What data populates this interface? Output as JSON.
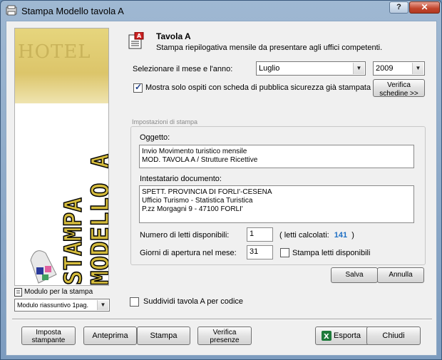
{
  "window": {
    "title": "Stampa Modello tavola A",
    "help_label": "?",
    "close_label": "✕"
  },
  "banner": {
    "hotel_word": "HOTEL",
    "vertical_line1": "STAMPA",
    "vertical_line2": "MODELLO A"
  },
  "header": {
    "title": "Tavola A",
    "subtitle": "Stampa riepilogativa mensile da presentare agli uffici competenti."
  },
  "period": {
    "label": "Selezionare il mese e l'anno:",
    "month": "Luglio",
    "year": "2009"
  },
  "filter": {
    "checked": true,
    "label": "Mostra solo ospiti con scheda di pubblica sicurezza già stampata",
    "verify_button_line1": "Verifica",
    "verify_button_line2": "schedine >>"
  },
  "settings": {
    "group_title": "Impostazioni di stampa",
    "subject_label": "Oggetto:",
    "subject_lines": [
      "Invio Movimento turistico mensile",
      "MOD. TAVOLA A / Strutture Ricettive"
    ],
    "recipient_label": "Intestatario documento:",
    "recipient_lines": [
      "SPETT. PROVINCIA DI FORLI'-CESENA",
      "Ufficio Turismo - Statistica Turistica",
      "P.zz Morgagni 9 - 47100 FORLI'"
    ],
    "beds_label": "Numero di letti disponibili:",
    "beds_value": "1",
    "beds_calc_prefix": "( letti calcolati:",
    "beds_calc_value": "141",
    "beds_calc_suffix": ")",
    "days_label": "Giorni di apertura nel mese:",
    "days_value": "31",
    "print_beds_checked": false,
    "print_beds_label": "Stampa letti disponibili",
    "save_label": "Salva",
    "cancel_label": "Annulla"
  },
  "module": {
    "label": "Modulo per la stampa",
    "selected": "Modulo riassuntivo 1pag."
  },
  "split": {
    "checked": false,
    "label": "Suddividi tavola A per codice"
  },
  "footer": {
    "printer_line1": "Imposta",
    "printer_line2": "stampante",
    "preview_label": "Anteprima",
    "print_label": "Stampa",
    "verify_line1": "Verifica",
    "verify_line2": "presenze",
    "export_label": "Esporta",
    "close_label": "Chiudi"
  },
  "colors": {
    "calc_value": "#1e6fc4",
    "banner_gold": "#dcc56a",
    "banner_text": "#b89a1e"
  }
}
